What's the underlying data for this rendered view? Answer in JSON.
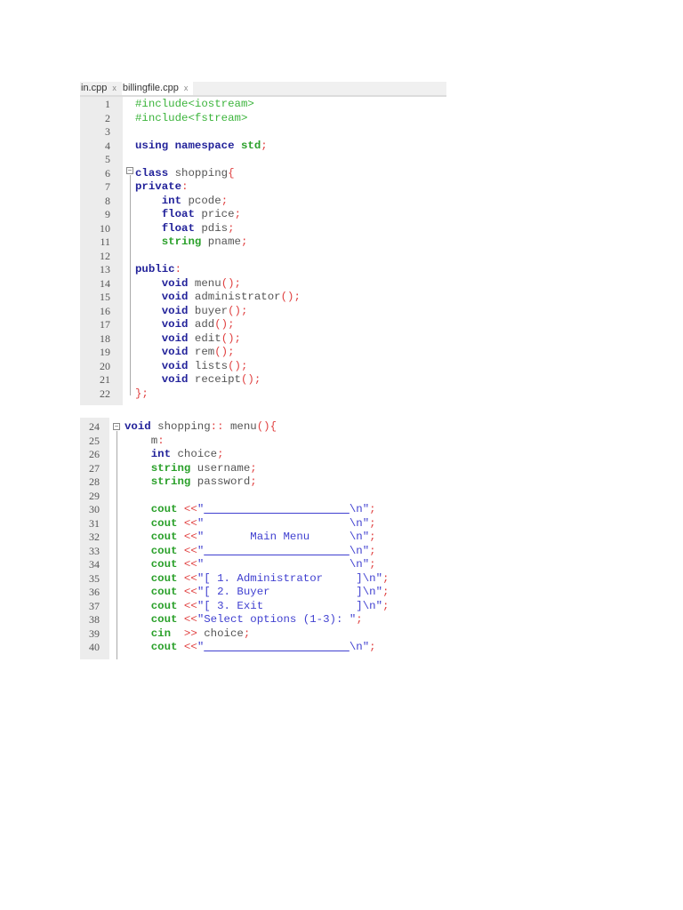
{
  "editor": {
    "tabs": [
      {
        "label": "in.cpp",
        "close": "x"
      },
      {
        "label": "billingfile.cpp",
        "close": "x"
      }
    ],
    "colors": {
      "keyword": "#22229a",
      "type": "#2aa02a",
      "preprocessor": "#3cb43c",
      "punctuation": "#e04040",
      "string": "#4040d0",
      "identifier": "#555555"
    },
    "panel1": [
      {
        "n": "1",
        "t": [
          [
            "pp",
            "#include<iostream>"
          ]
        ]
      },
      {
        "n": "2",
        "t": [
          [
            "pp",
            "#include<fstream>"
          ]
        ]
      },
      {
        "n": "3",
        "t": []
      },
      {
        "n": "4",
        "t": [
          [
            "kw",
            "using namespace "
          ],
          [
            "ty",
            "std"
          ],
          [
            "pu",
            ";"
          ]
        ]
      },
      {
        "n": "5",
        "t": []
      },
      {
        "n": "6",
        "t": [
          [
            "kw",
            "class"
          ],
          [
            "id",
            " shopping"
          ],
          [
            "pu",
            "{"
          ]
        ]
      },
      {
        "n": "7",
        "t": [
          [
            "kw",
            "private"
          ],
          [
            "pu",
            ":"
          ]
        ]
      },
      {
        "n": "8",
        "t": [
          [
            "id",
            "    "
          ],
          [
            "kw",
            "int"
          ],
          [
            "id",
            " pcode"
          ],
          [
            "pu",
            ";"
          ]
        ]
      },
      {
        "n": "9",
        "t": [
          [
            "id",
            "    "
          ],
          [
            "kw",
            "float"
          ],
          [
            "id",
            " price"
          ],
          [
            "pu",
            ";"
          ]
        ]
      },
      {
        "n": "10",
        "t": [
          [
            "id",
            "    "
          ],
          [
            "kw",
            "float"
          ],
          [
            "id",
            " pdis"
          ],
          [
            "pu",
            ";"
          ]
        ]
      },
      {
        "n": "11",
        "t": [
          [
            "id",
            "    "
          ],
          [
            "ty",
            "string"
          ],
          [
            "id",
            " pname"
          ],
          [
            "pu",
            ";"
          ]
        ]
      },
      {
        "n": "12",
        "t": []
      },
      {
        "n": "13",
        "t": [
          [
            "kw",
            "public"
          ],
          [
            "pu",
            ":"
          ]
        ]
      },
      {
        "n": "14",
        "t": [
          [
            "id",
            "    "
          ],
          [
            "kw",
            "void"
          ],
          [
            "id",
            " menu"
          ],
          [
            "pu",
            "();"
          ]
        ]
      },
      {
        "n": "15",
        "t": [
          [
            "id",
            "    "
          ],
          [
            "kw",
            "void"
          ],
          [
            "id",
            " administrator"
          ],
          [
            "pu",
            "();"
          ]
        ]
      },
      {
        "n": "16",
        "t": [
          [
            "id",
            "    "
          ],
          [
            "kw",
            "void"
          ],
          [
            "id",
            " buyer"
          ],
          [
            "pu",
            "();"
          ]
        ]
      },
      {
        "n": "17",
        "t": [
          [
            "id",
            "    "
          ],
          [
            "kw",
            "void"
          ],
          [
            "id",
            " add"
          ],
          [
            "pu",
            "();"
          ]
        ]
      },
      {
        "n": "18",
        "t": [
          [
            "id",
            "    "
          ],
          [
            "kw",
            "void"
          ],
          [
            "id",
            " edit"
          ],
          [
            "pu",
            "();"
          ]
        ]
      },
      {
        "n": "19",
        "t": [
          [
            "id",
            "    "
          ],
          [
            "kw",
            "void"
          ],
          [
            "id",
            " rem"
          ],
          [
            "pu",
            "();"
          ]
        ]
      },
      {
        "n": "20",
        "t": [
          [
            "id",
            "    "
          ],
          [
            "kw",
            "void"
          ],
          [
            "id",
            " lists"
          ],
          [
            "pu",
            "();"
          ]
        ]
      },
      {
        "n": "21",
        "t": [
          [
            "id",
            "    "
          ],
          [
            "kw",
            "void"
          ],
          [
            "id",
            " receipt"
          ],
          [
            "pu",
            "();"
          ]
        ]
      },
      {
        "n": "22",
        "t": [
          [
            "pu",
            "};"
          ]
        ]
      }
    ],
    "panel2": [
      {
        "n": "24",
        "t": [
          [
            "kw",
            "void"
          ],
          [
            "id",
            " shopping"
          ],
          [
            "pu",
            "::"
          ],
          [
            "id",
            " menu"
          ],
          [
            "pu",
            "(){"
          ]
        ]
      },
      {
        "n": "25",
        "t": [
          [
            "id",
            "    m"
          ],
          [
            "pu",
            ":"
          ]
        ]
      },
      {
        "n": "26",
        "t": [
          [
            "id",
            "    "
          ],
          [
            "kw",
            "int"
          ],
          [
            "id",
            " choice"
          ],
          [
            "pu",
            ";"
          ]
        ]
      },
      {
        "n": "27",
        "t": [
          [
            "id",
            "    "
          ],
          [
            "ty",
            "string"
          ],
          [
            "id",
            " username"
          ],
          [
            "pu",
            ";"
          ]
        ]
      },
      {
        "n": "28",
        "t": [
          [
            "id",
            "    "
          ],
          [
            "ty",
            "string"
          ],
          [
            "id",
            " password"
          ],
          [
            "pu",
            ";"
          ]
        ]
      },
      {
        "n": "29",
        "t": []
      },
      {
        "n": "30",
        "t": [
          [
            "id",
            "    "
          ],
          [
            "ty",
            "cout"
          ],
          [
            "pu",
            " <<"
          ],
          [
            "st",
            "\""
          ],
          [
            "ul",
            "                      "
          ],
          [
            "st",
            "\\n\""
          ],
          [
            "pu",
            ";"
          ]
        ]
      },
      {
        "n": "31",
        "t": [
          [
            "id",
            "    "
          ],
          [
            "ty",
            "cout"
          ],
          [
            "pu",
            " <<"
          ],
          [
            "st",
            "\"                      \\n\""
          ],
          [
            "pu",
            ";"
          ]
        ]
      },
      {
        "n": "32",
        "t": [
          [
            "id",
            "    "
          ],
          [
            "ty",
            "cout"
          ],
          [
            "pu",
            " <<"
          ],
          [
            "st",
            "\"       Main Menu      \\n\""
          ],
          [
            "pu",
            ";"
          ]
        ]
      },
      {
        "n": "33",
        "t": [
          [
            "id",
            "    "
          ],
          [
            "ty",
            "cout"
          ],
          [
            "pu",
            " <<"
          ],
          [
            "st",
            "\""
          ],
          [
            "ul",
            "                      "
          ],
          [
            "st",
            "\\n\""
          ],
          [
            "pu",
            ";"
          ]
        ]
      },
      {
        "n": "34",
        "t": [
          [
            "id",
            "    "
          ],
          [
            "ty",
            "cout"
          ],
          [
            "pu",
            " <<"
          ],
          [
            "st",
            "\"                      \\n\""
          ],
          [
            "pu",
            ";"
          ]
        ]
      },
      {
        "n": "35",
        "t": [
          [
            "id",
            "    "
          ],
          [
            "ty",
            "cout"
          ],
          [
            "pu",
            " <<"
          ],
          [
            "st",
            "\"[ 1. Administrator     ]\\n\""
          ],
          [
            "pu",
            ";"
          ]
        ]
      },
      {
        "n": "36",
        "t": [
          [
            "id",
            "    "
          ],
          [
            "ty",
            "cout"
          ],
          [
            "pu",
            " <<"
          ],
          [
            "st",
            "\"[ 2. Buyer             ]\\n\""
          ],
          [
            "pu",
            ";"
          ]
        ]
      },
      {
        "n": "37",
        "t": [
          [
            "id",
            "    "
          ],
          [
            "ty",
            "cout"
          ],
          [
            "pu",
            " <<"
          ],
          [
            "st",
            "\"[ 3. Exit              ]\\n\""
          ],
          [
            "pu",
            ";"
          ]
        ]
      },
      {
        "n": "38",
        "t": [
          [
            "id",
            "    "
          ],
          [
            "ty",
            "cout"
          ],
          [
            "pu",
            " <<"
          ],
          [
            "st",
            "\"Select options (1-3): \""
          ],
          [
            "pu",
            ";"
          ]
        ]
      },
      {
        "n": "39",
        "t": [
          [
            "id",
            "    "
          ],
          [
            "ty",
            "cin"
          ],
          [
            "pu",
            "  >>"
          ],
          [
            "id",
            " choice"
          ],
          [
            "pu",
            ";"
          ]
        ]
      },
      {
        "n": "40",
        "t": [
          [
            "id",
            "    "
          ],
          [
            "ty",
            "cout"
          ],
          [
            "pu",
            " <<"
          ],
          [
            "st",
            "\""
          ],
          [
            "ul",
            "                      "
          ],
          [
            "st",
            "\\n\""
          ],
          [
            "pu",
            ";"
          ]
        ]
      }
    ]
  }
}
